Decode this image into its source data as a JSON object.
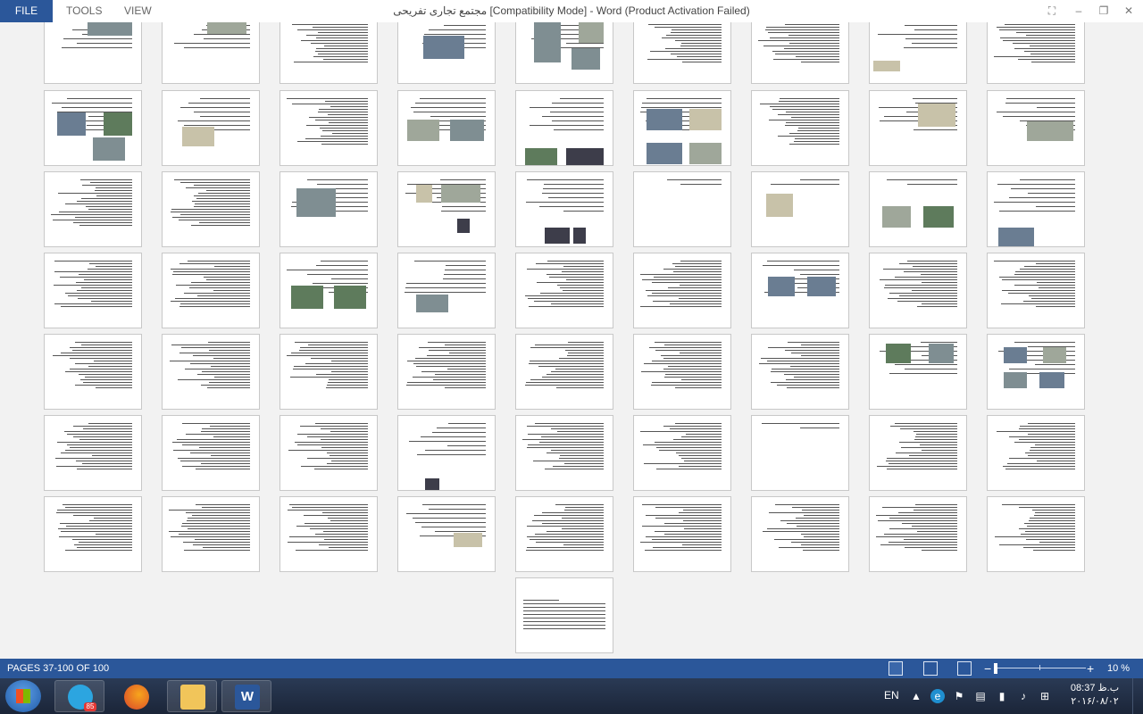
{
  "titlebar": {
    "tabs": {
      "file": "FILE",
      "tools": "TOOLS",
      "view": "VIEW"
    },
    "title": "مجتمع تجاری تفریحی [Compatibility Mode] - Word (Product Activation Failed)",
    "buttons": {
      "fullscreen": "⛶",
      "minimize": "–",
      "restore": "❐",
      "close": "✕"
    }
  },
  "status": {
    "pages": "PAGES 37-100 OF 100",
    "zoom_minus": "−",
    "zoom_plus": "+",
    "zoom_level": "10 %",
    "zoom_value_percent": 10
  },
  "taskbar": {
    "apps": [
      {
        "name": "Telegram",
        "icon": "telegram-icon",
        "badge": "85"
      },
      {
        "name": "Firefox",
        "icon": "firefox-icon"
      },
      {
        "name": "Windows Explorer",
        "icon": "folder-icon"
      },
      {
        "name": "Microsoft Word",
        "icon": "word-icon",
        "label": "W"
      }
    ],
    "tray": {
      "language": "EN",
      "time": "08:37 ب.ظ",
      "date": "۲۰۱۶/۰۸/۰۲"
    }
  },
  "colors": {
    "accent": "#2b579a",
    "page": "#ffffff",
    "background": "#f2f2f2"
  }
}
